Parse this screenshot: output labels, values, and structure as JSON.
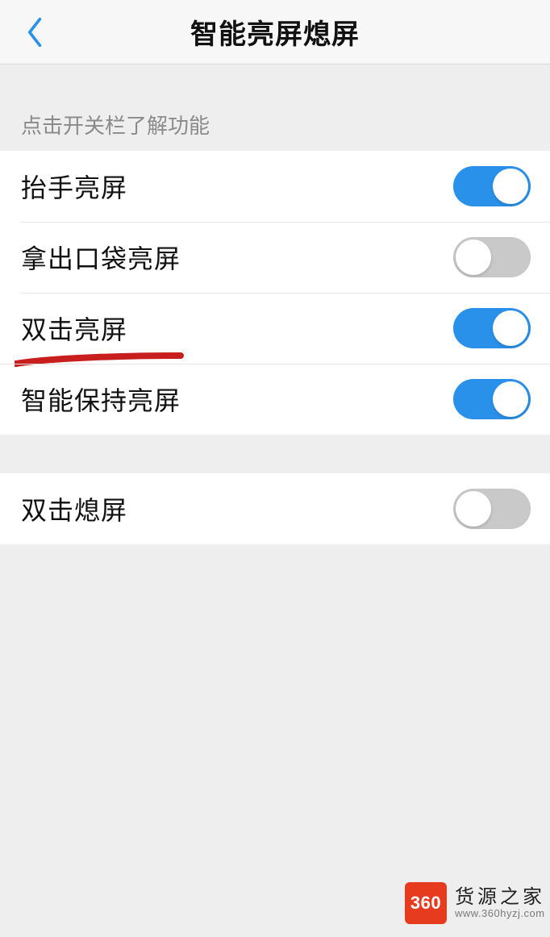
{
  "header": {
    "title": "智能亮屏熄屏"
  },
  "hint": "点击开关栏了解功能",
  "group1": [
    {
      "label": "抬手亮屏",
      "on": true
    },
    {
      "label": "拿出口袋亮屏",
      "on": false
    },
    {
      "label": "双击亮屏",
      "on": true,
      "underlined": true
    },
    {
      "label": "智能保持亮屏",
      "on": true,
      "fullsep": true
    }
  ],
  "group2": [
    {
      "label": "双击熄屏",
      "on": false
    }
  ],
  "watermark": {
    "badge": "360",
    "title": "货源之家",
    "url": "www.360hyzj.com"
  }
}
